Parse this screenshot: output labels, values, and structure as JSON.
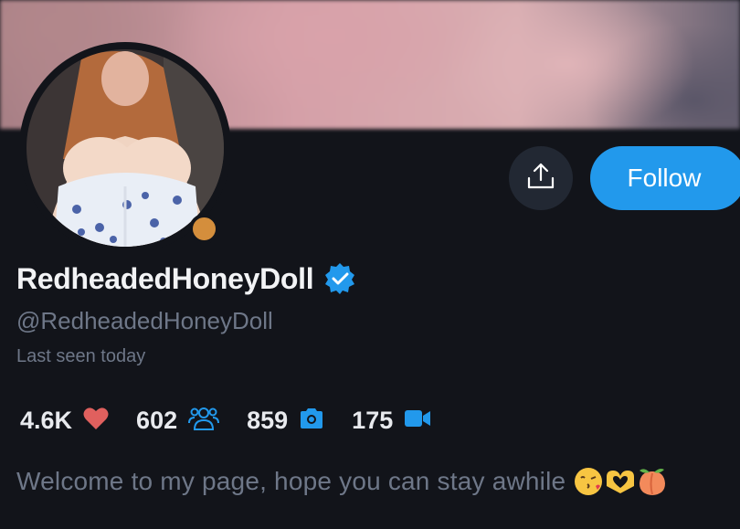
{
  "profile": {
    "display_name": "RedheadedHoneyDoll",
    "handle": "@RedheadedHoneyDoll",
    "last_seen": "Last seen today",
    "verified": true,
    "online_status_color": "#d48e3c"
  },
  "actions": {
    "share_icon": "share-upload-icon",
    "follow_label": "Follow"
  },
  "stats": [
    {
      "value": "4.6K",
      "icon": "heart-icon",
      "color": "#e0605e"
    },
    {
      "value": "602",
      "icon": "subscribers-icon",
      "color": "#2299ec"
    },
    {
      "value": "859",
      "icon": "camera-icon",
      "color": "#2299ec"
    },
    {
      "value": "175",
      "icon": "video-icon",
      "color": "#2299ec"
    }
  ],
  "bio": {
    "text": "Welcome to my page, hope you can stay awhile",
    "emojis": [
      "kissing-face-emoji",
      "heart-hands-emoji",
      "peach-emoji"
    ]
  },
  "colors": {
    "accent": "#2299ec",
    "background": "#12141a",
    "muted_text": "#6e7788"
  }
}
